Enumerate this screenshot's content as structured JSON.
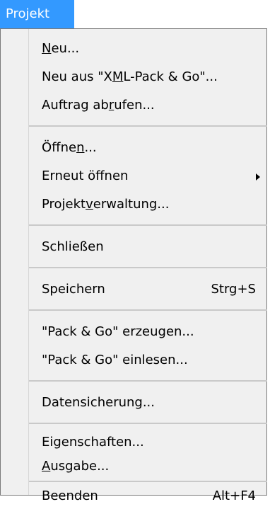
{
  "menu": {
    "title": "Projekt",
    "items": [
      {
        "id": "neu",
        "label": "Neu...",
        "mnemonic_index": 0
      },
      {
        "id": "neu-xml",
        "label": "Neu aus \"XML-Pack & Go\"...",
        "mnemonic_index": 10
      },
      {
        "id": "auftrag",
        "label": "Auftrag abrufen...",
        "mnemonic_index": 10
      },
      {
        "id": "oeffnen",
        "label": "Öffnen...",
        "mnemonic_index": 5
      },
      {
        "id": "erneut",
        "label": "Erneut öffnen",
        "mnemonic_index": null,
        "submenu": true
      },
      {
        "id": "projektverwaltung",
        "label": "Projektverwaltung...",
        "mnemonic_index": 7
      },
      {
        "id": "schliessen",
        "label": "Schließen",
        "mnemonic_index": null
      },
      {
        "id": "speichern",
        "label": "Speichern",
        "shortcut": "Strg+S",
        "mnemonic_index": null
      },
      {
        "id": "pack-erzeugen",
        "label": "\"Pack & Go\" erzeugen...",
        "mnemonic_index": null
      },
      {
        "id": "pack-einlesen",
        "label": "\"Pack & Go\" einlesen...",
        "mnemonic_index": null
      },
      {
        "id": "datensicherung",
        "label": "Datensicherung...",
        "mnemonic_index": null
      },
      {
        "id": "eigenschaften",
        "label": "Eigenschaften...",
        "mnemonic_index": null
      },
      {
        "id": "ausgabe",
        "label": "Ausgabe...",
        "mnemonic_index": 0
      },
      {
        "id": "beenden",
        "label": "Beenden",
        "shortcut": "Alt+F4",
        "mnemonic_index": null
      }
    ]
  },
  "colors": {
    "menu_title_bg": "#3399ff",
    "menu_bg": "#f0f0f0",
    "separator": "#c9c9c9"
  }
}
